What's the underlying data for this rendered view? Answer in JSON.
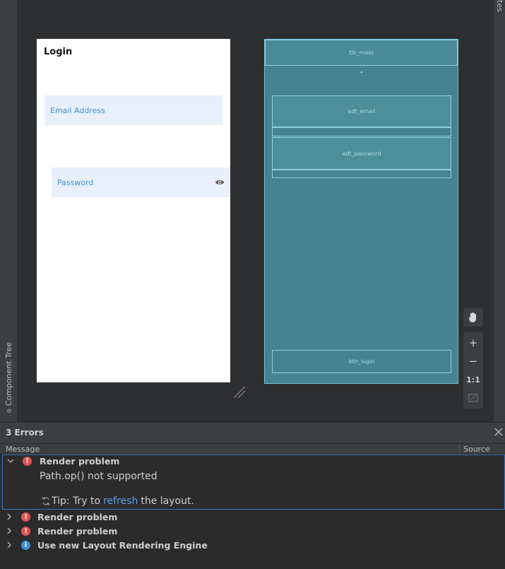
{
  "side_panels": {
    "component_tree_label": "Component Tree",
    "right_label": "tes"
  },
  "design": {
    "title": "Login",
    "email_hint": "Email Address",
    "password_hint": "Password"
  },
  "blueprint": {
    "toolbar_id": "tlb_main",
    "email_id": "edt_email",
    "password_id": "edt_password",
    "login_id": "btn_login"
  },
  "zoom_toolbar": {
    "zoom_in": "+",
    "zoom_out": "−",
    "actual_size": "1:1"
  },
  "errors_panel": {
    "title": "3 Errors",
    "columns": {
      "message": "Message",
      "source": "Source"
    },
    "rows": [
      {
        "label": "Render problem",
        "type": "error",
        "expanded": true
      },
      {
        "label": "Render problem",
        "type": "error",
        "expanded": false
      },
      {
        "label": "Render problem",
        "type": "error",
        "expanded": false
      },
      {
        "label": "Use new Layout Rendering Engine",
        "type": "info",
        "expanded": false
      }
    ],
    "detail": "Path.op() not supported",
    "tip": {
      "prefix": "Tip: Try to",
      "link": "refresh",
      "suffix": "the layout."
    }
  },
  "colors": {
    "blueprint_bg": "#44838f",
    "field_bg": "#e8f0fc",
    "hint_text": "#3d8fd6",
    "error_badge": "#e05555",
    "info_badge": "#3d8fd6",
    "link": "#5ea1ec"
  }
}
